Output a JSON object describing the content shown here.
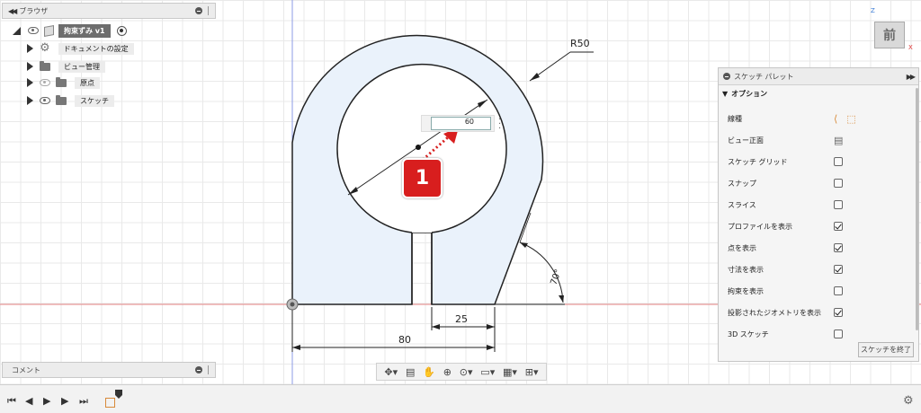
{
  "browser": {
    "title": "ブラウザ",
    "document": {
      "label": "拘束ずみ v1"
    },
    "items": [
      {
        "label": "ドキュメントの設定",
        "icon": "gear-icon"
      },
      {
        "label": "ビュー管理",
        "icon": "folder-icon"
      },
      {
        "label": "原点",
        "icon": "folder-icon",
        "visible": false
      },
      {
        "label": "スケッチ",
        "icon": "folder-icon",
        "visible": true
      }
    ]
  },
  "comments": {
    "title": "コメント"
  },
  "viewcube": {
    "face": "前",
    "axis_z": "Z",
    "axis_x": "X"
  },
  "sketch": {
    "radius_label": "R50",
    "angle_label": "70°",
    "width_label": "80",
    "slot_label": "25",
    "dim_input_value": "60"
  },
  "callout": {
    "number": "1"
  },
  "palette": {
    "title": "スケッチ パレット",
    "section": "オプション",
    "rows": [
      {
        "label": "線種",
        "control": "linetype"
      },
      {
        "label": "ビュー正面",
        "control": "icon"
      },
      {
        "label": "スケッチ グリッド",
        "control": "checkbox",
        "checked": false
      },
      {
        "label": "スナップ",
        "control": "checkbox",
        "checked": false
      },
      {
        "label": "スライス",
        "control": "checkbox",
        "checked": false
      },
      {
        "label": "プロファイルを表示",
        "control": "checkbox",
        "checked": true
      },
      {
        "label": "点を表示",
        "control": "checkbox",
        "checked": true
      },
      {
        "label": "寸法を表示",
        "control": "checkbox",
        "checked": true
      },
      {
        "label": "拘束を表示",
        "control": "checkbox",
        "checked": false
      },
      {
        "label": "投影されたジオメトリを表示",
        "control": "checkbox",
        "checked": true
      },
      {
        "label": "3D スケッチ",
        "control": "checkbox",
        "checked": false
      }
    ],
    "finish_label": "スケッチを終了"
  },
  "colors": {
    "profile_fill": "#eaf2fb",
    "dimension_line": "#222222",
    "badge": "#d81e1e",
    "x_axis": "#e05a5a",
    "y_axis": "#7a8fe0"
  }
}
